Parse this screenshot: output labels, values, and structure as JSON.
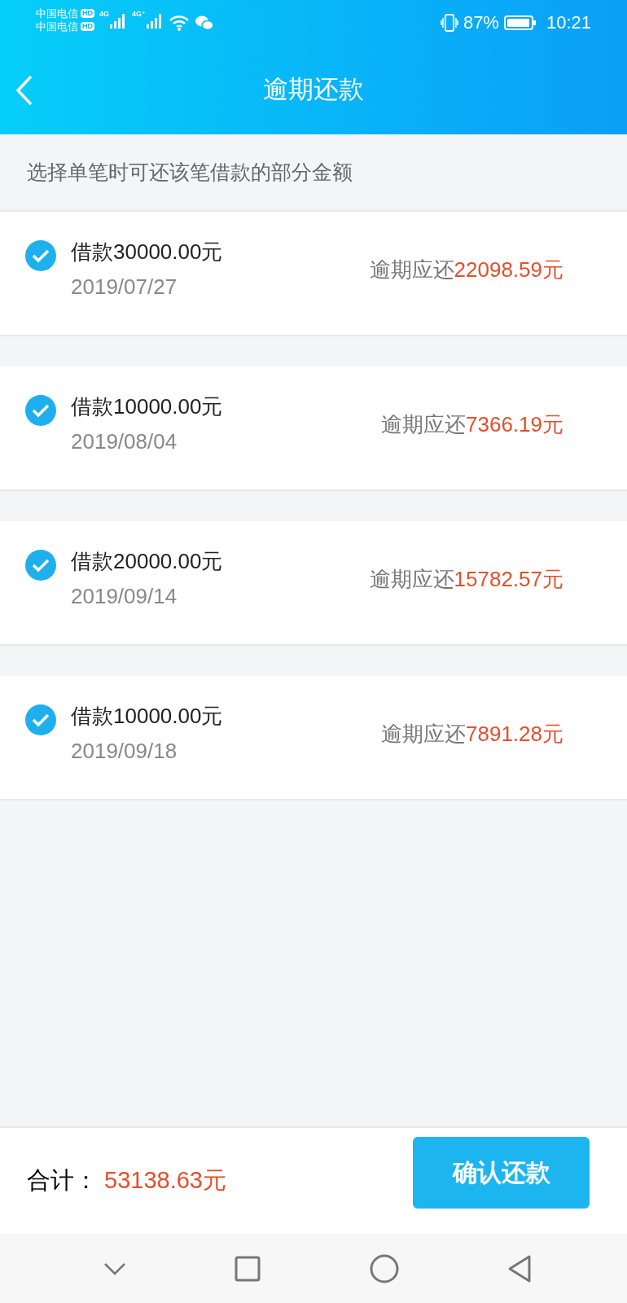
{
  "status_bar": {
    "carriers": [
      {
        "name": "中国电信",
        "badge": "HD"
      },
      {
        "name": "中国电信",
        "badge": "HD"
      }
    ],
    "signals": [
      {
        "label": "4G"
      },
      {
        "label": "4G⁺"
      }
    ],
    "battery_percent": "87%",
    "time": "10:21"
  },
  "header": {
    "title": "逾期还款"
  },
  "hint": "选择单笔时可还该笔借款的部分金额",
  "loans": [
    {
      "title": "借款30000.00元",
      "date": "2019/07/27",
      "due_label": "逾期应还",
      "due_amount": "22098.59元",
      "checked": true
    },
    {
      "title": "借款10000.00元",
      "date": "2019/08/04",
      "due_label": "逾期应还",
      "due_amount": "7366.19元",
      "checked": true
    },
    {
      "title": "借款20000.00元",
      "date": "2019/09/14",
      "due_label": "逾期应还",
      "due_amount": "15782.57元",
      "checked": true
    },
    {
      "title": "借款10000.00元",
      "date": "2019/09/18",
      "due_label": "逾期应还",
      "due_amount": "7891.28元",
      "checked": true
    }
  ],
  "footer": {
    "total_label": "合计：",
    "total_amount": "53138.63元",
    "confirm_button": "确认还款"
  }
}
